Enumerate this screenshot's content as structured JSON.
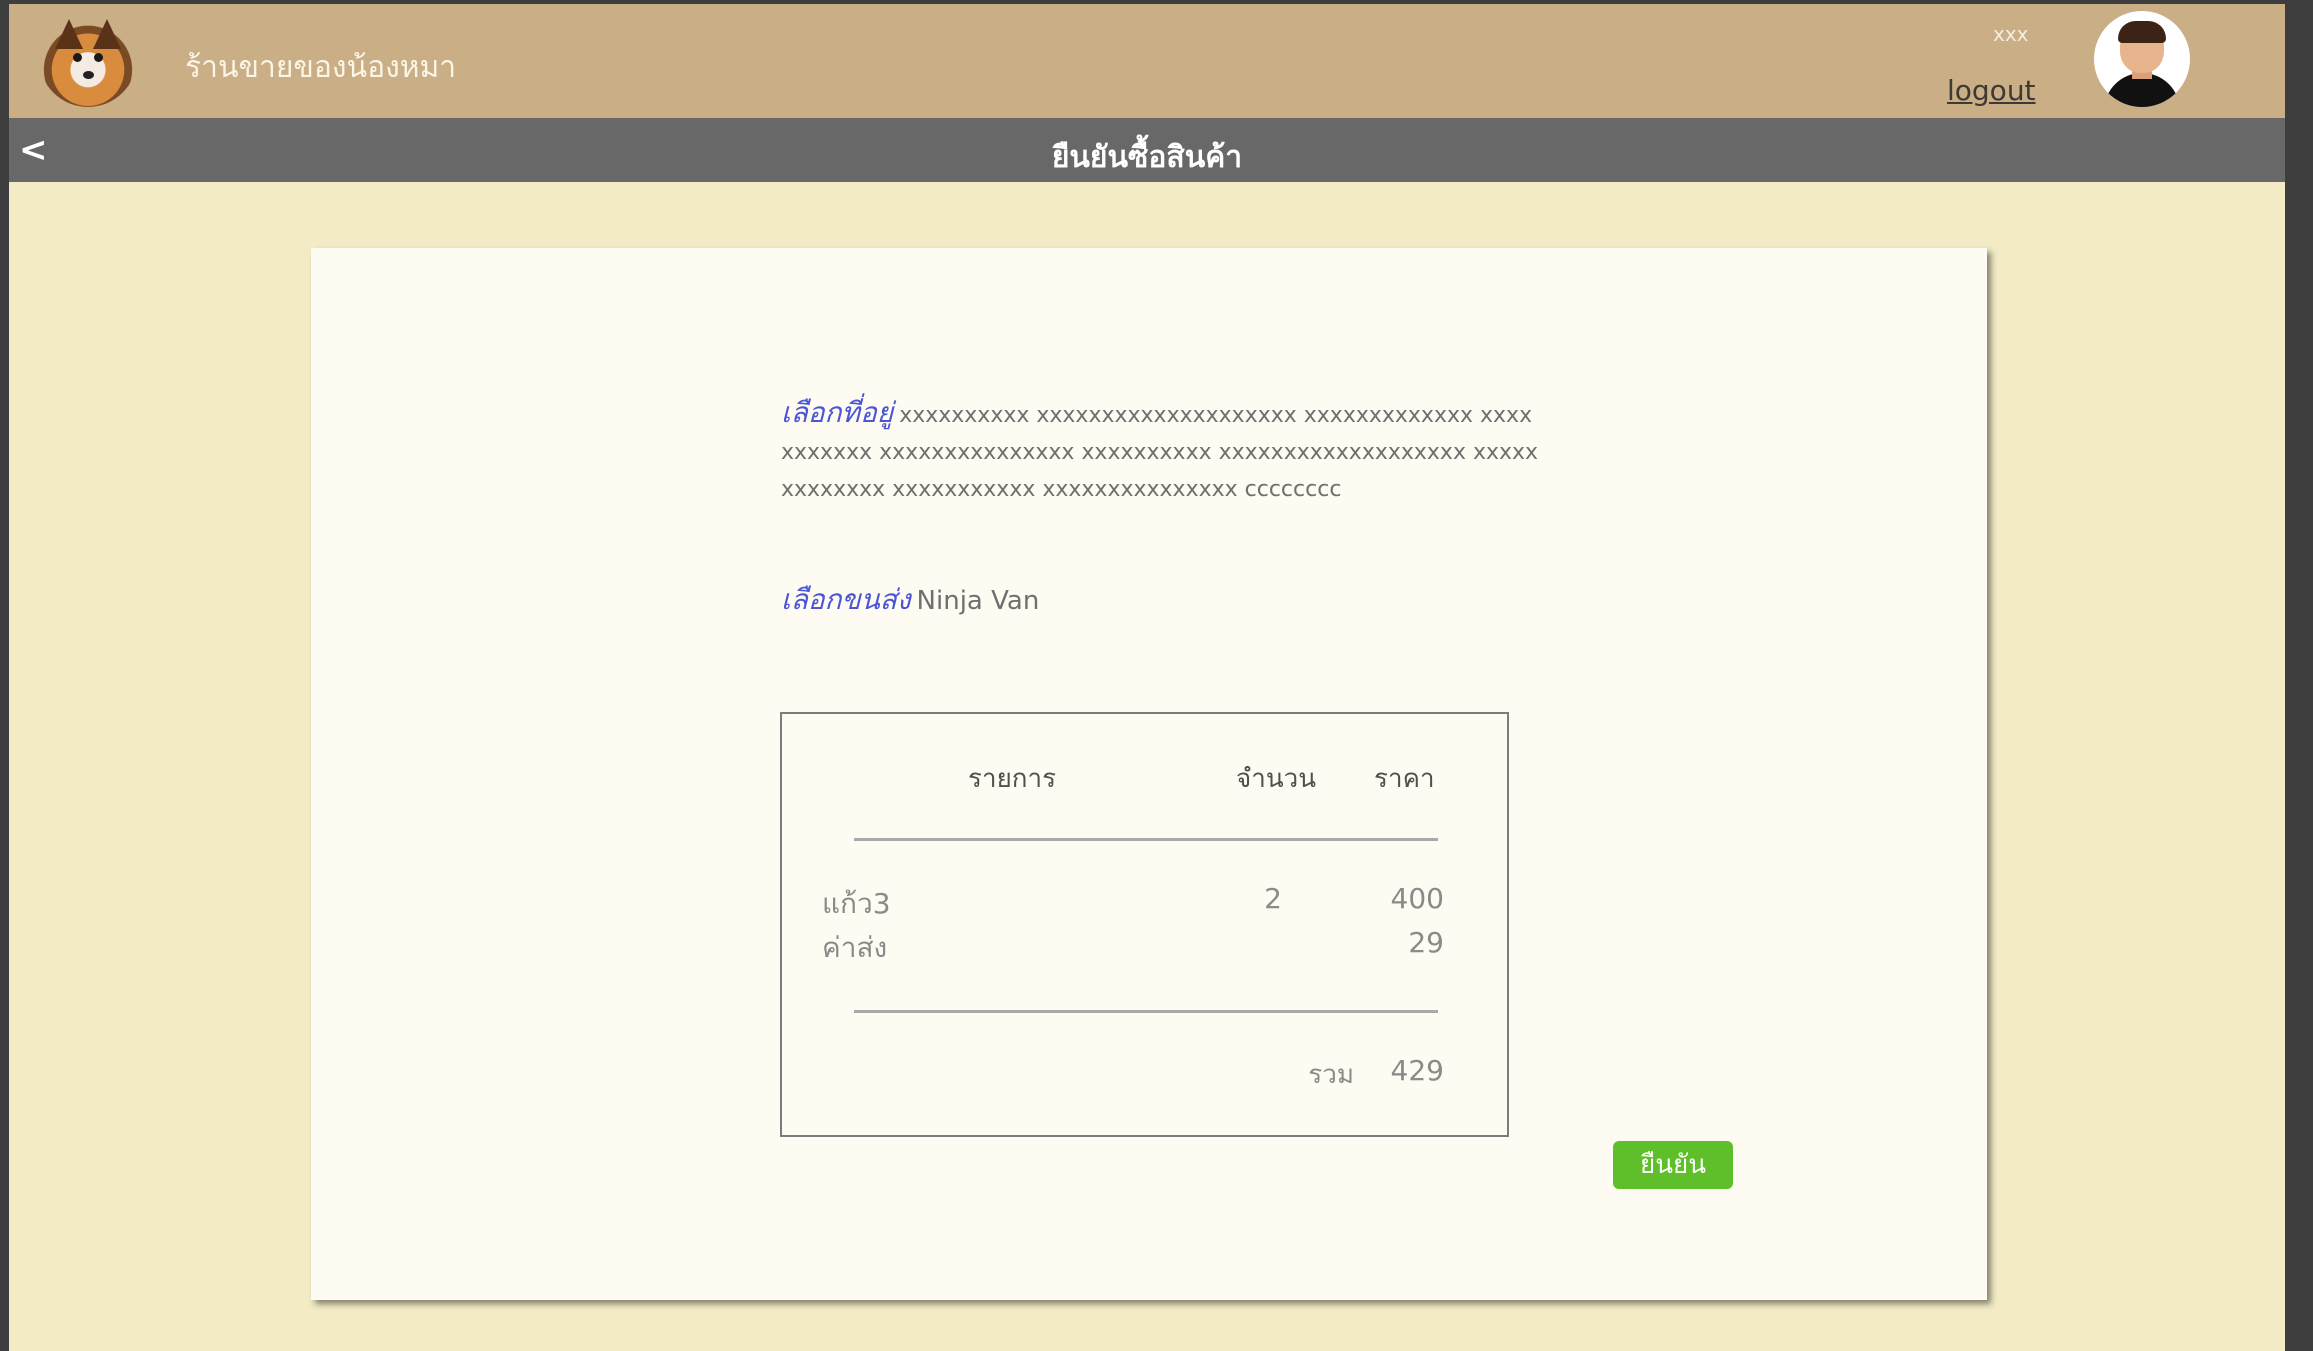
{
  "header": {
    "shop_name": "ร้านขายของน้องหมา",
    "user_name": "xxx",
    "logout_label": "logout"
  },
  "titlebar": {
    "back_label": "<",
    "title": "ยืนยันซื้อสินค้า"
  },
  "address": {
    "label": "เลือกที่อยู่",
    "value": "xxxxxxxxxx xxxxxxxxxxxxxxxxxxxx xxxxxxxxxxxxx xxxxxxxxxxx xxxxxxxxxxxxxxx xxxxxxxxxx xxxxxxxxxxxxxxxxxxx xxxxxxxxxxxxx xxxxxxxxxxx xxxxxxxxxxxxxxx cccccccc"
  },
  "shipping": {
    "label": "เลือกขนส่ง",
    "value": "Ninja Van"
  },
  "order_table": {
    "headers": {
      "item": "รายการ",
      "qty": "จำนวน",
      "price": "ราคา"
    },
    "rows": [
      {
        "item": "แก้ว3",
        "qty": "2",
        "price": "400"
      },
      {
        "item": "ค่าส่ง",
        "qty": "",
        "price": "29"
      }
    ],
    "total_label": "รวม",
    "total_value": "429"
  },
  "confirm_label": "ยืนยัน",
  "colors": {
    "topbar": "#c9ae86",
    "titlebar": "#686868",
    "page_bg": "#f3ebc6",
    "card_bg": "#fdfbf2",
    "label_blue": "#4b55d6",
    "confirm_green": "#5fbf2a"
  },
  "icons": {
    "logo": "dog-logo-icon",
    "avatar": "user-avatar-icon"
  }
}
